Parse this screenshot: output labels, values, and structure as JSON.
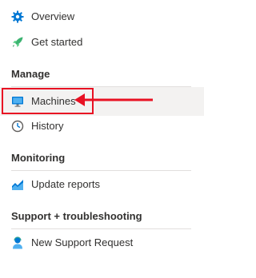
{
  "nav": {
    "overview": {
      "label": "Overview",
      "icon": "gear-icon"
    },
    "get_started": {
      "label": "Get started",
      "icon": "rocket-icon"
    },
    "machines": {
      "label": "Machines",
      "icon": "monitor-icon",
      "selected": true
    },
    "history": {
      "label": "History",
      "icon": "clock-icon"
    },
    "update_reports": {
      "label": "Update reports",
      "icon": "area-chart-icon"
    },
    "new_support_request": {
      "label": "New Support Request",
      "icon": "support-person-icon"
    }
  },
  "sections": {
    "manage": "Manage",
    "monitoring": "Monitoring",
    "support": "Support + troubleshooting"
  },
  "colors": {
    "accent": "#0078d4",
    "highlight": "#e81123",
    "selected_bg": "#f3f2f1"
  }
}
